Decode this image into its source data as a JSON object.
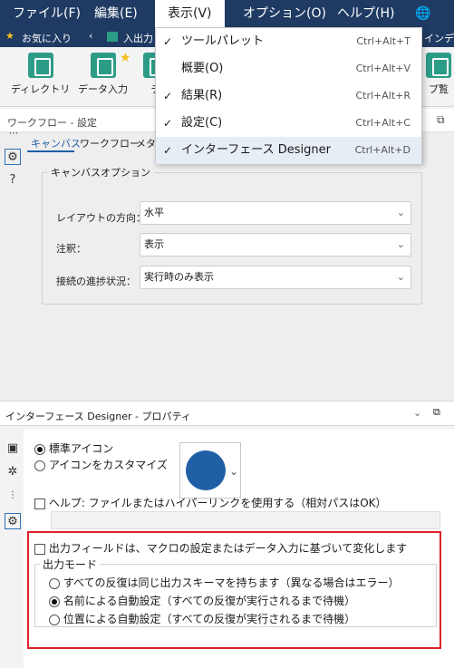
{
  "menubar": {
    "items": [
      "ファイル(F)",
      "編集(E)",
      "表示(V)",
      "オプション(O)",
      "ヘルプ(H)"
    ],
    "globe": "🌐"
  },
  "tabbar": {
    "favorites": "お気に入り",
    "tab_label": "入出力",
    "tab_right": "インデ"
  },
  "ribbon": {
    "tools": [
      "ディレクトリ",
      "データ入力",
      "デ",
      "プ覧"
    ]
  },
  "config": {
    "title": "ワークフロー - 設定",
    "tabs": [
      "キャンバス",
      "ワークフロー",
      "メタ"
    ],
    "group_title": "キャンバスオプション",
    "fields": [
      {
        "label": "レイアウトの方向：",
        "value": "水平"
      },
      {
        "label": "注釈：",
        "value": "表示"
      },
      {
        "label": "接続の進捗状況：",
        "value": "実行時のみ表示"
      }
    ]
  },
  "interface": {
    "title": "インターフェース Designer - プロパティ",
    "std_icon": "標準アイコン",
    "custom_icon": "アイコンをカスタマイズ",
    "help_label": "ヘルプ: ファイルまたはハイパーリンクを使用する（相対パスはOK）",
    "output_field_label": "出力フィールドは、マクロの設定またはデータ入力に基づいて変化します",
    "output_mode_title": "出力モード",
    "modes": [
      "すべての反復は同じ出力スキーマを持ちます（異なる場合はエラー）",
      "名前による自動設定（すべての反復が実行されるまで待機）",
      "位置による自動設定（すべての反復が実行されるまで待機）"
    ],
    "selected_mode_index": 1,
    "icon_color": "#1f5fa6"
  },
  "dropdown": {
    "items": [
      {
        "label": "ツールパレット",
        "shortcut": "Ctrl+Alt+T",
        "checked": true
      },
      {
        "label": "概要(O)",
        "shortcut": "Ctrl+Alt+V",
        "checked": false
      },
      {
        "label": "結果(R)",
        "shortcut": "Ctrl+Alt+R",
        "checked": true
      },
      {
        "label": "設定(C)",
        "shortcut": "Ctrl+Alt+C",
        "checked": true
      },
      {
        "label": "インターフェース Designer",
        "shortcut": "Ctrl+Alt+D",
        "checked": true
      }
    ],
    "check_mark": "✓"
  },
  "colors": {
    "menubar": "#1f3b63",
    "accent": "#2c9c87",
    "highlight_box": "#e0202a"
  }
}
